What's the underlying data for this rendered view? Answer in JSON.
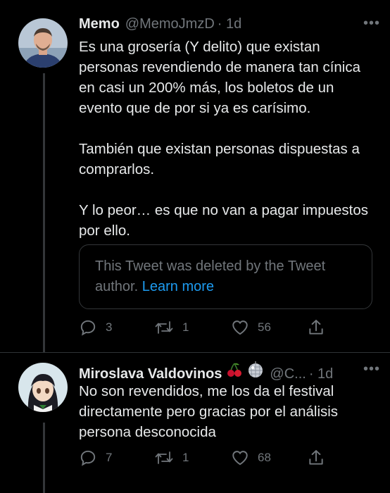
{
  "tweets": [
    {
      "name": "Memo",
      "handle": "@MemoJmzD",
      "time": "· 1d",
      "more": "•••",
      "paragraphs": [
        "Es una grosería (Y delito) que existan personas revendiendo de manera tan cínica en casi un 200% más, los boletos de un evento que de por si ya es carísimo.",
        "También que existan personas dispuestas a comprarlos.",
        "Y lo peor… es que no van a pagar impuestos por ello."
      ],
      "quote": {
        "text": "This Tweet was deleted by the Tweet author.",
        "link": "Learn more"
      },
      "replies": "3",
      "retweets": "1",
      "likes": "56"
    },
    {
      "name": "Miroslava Valdovinos",
      "handle": "@C...",
      "time": "· 1d",
      "more": "•••",
      "emojis": [
        "cherries-emoji",
        "disco-ball-emoji"
      ],
      "paragraphs": [
        "No son revendidos, me los da el festival directamente pero gracias por el análisis persona desconocida"
      ],
      "replies": "7",
      "retweets": "1",
      "likes": "68"
    }
  ],
  "colors": {
    "background": "#000000",
    "text": "#e7e9ea",
    "muted": "#71767b",
    "link": "#1d9bf0",
    "border": "#333639"
  }
}
